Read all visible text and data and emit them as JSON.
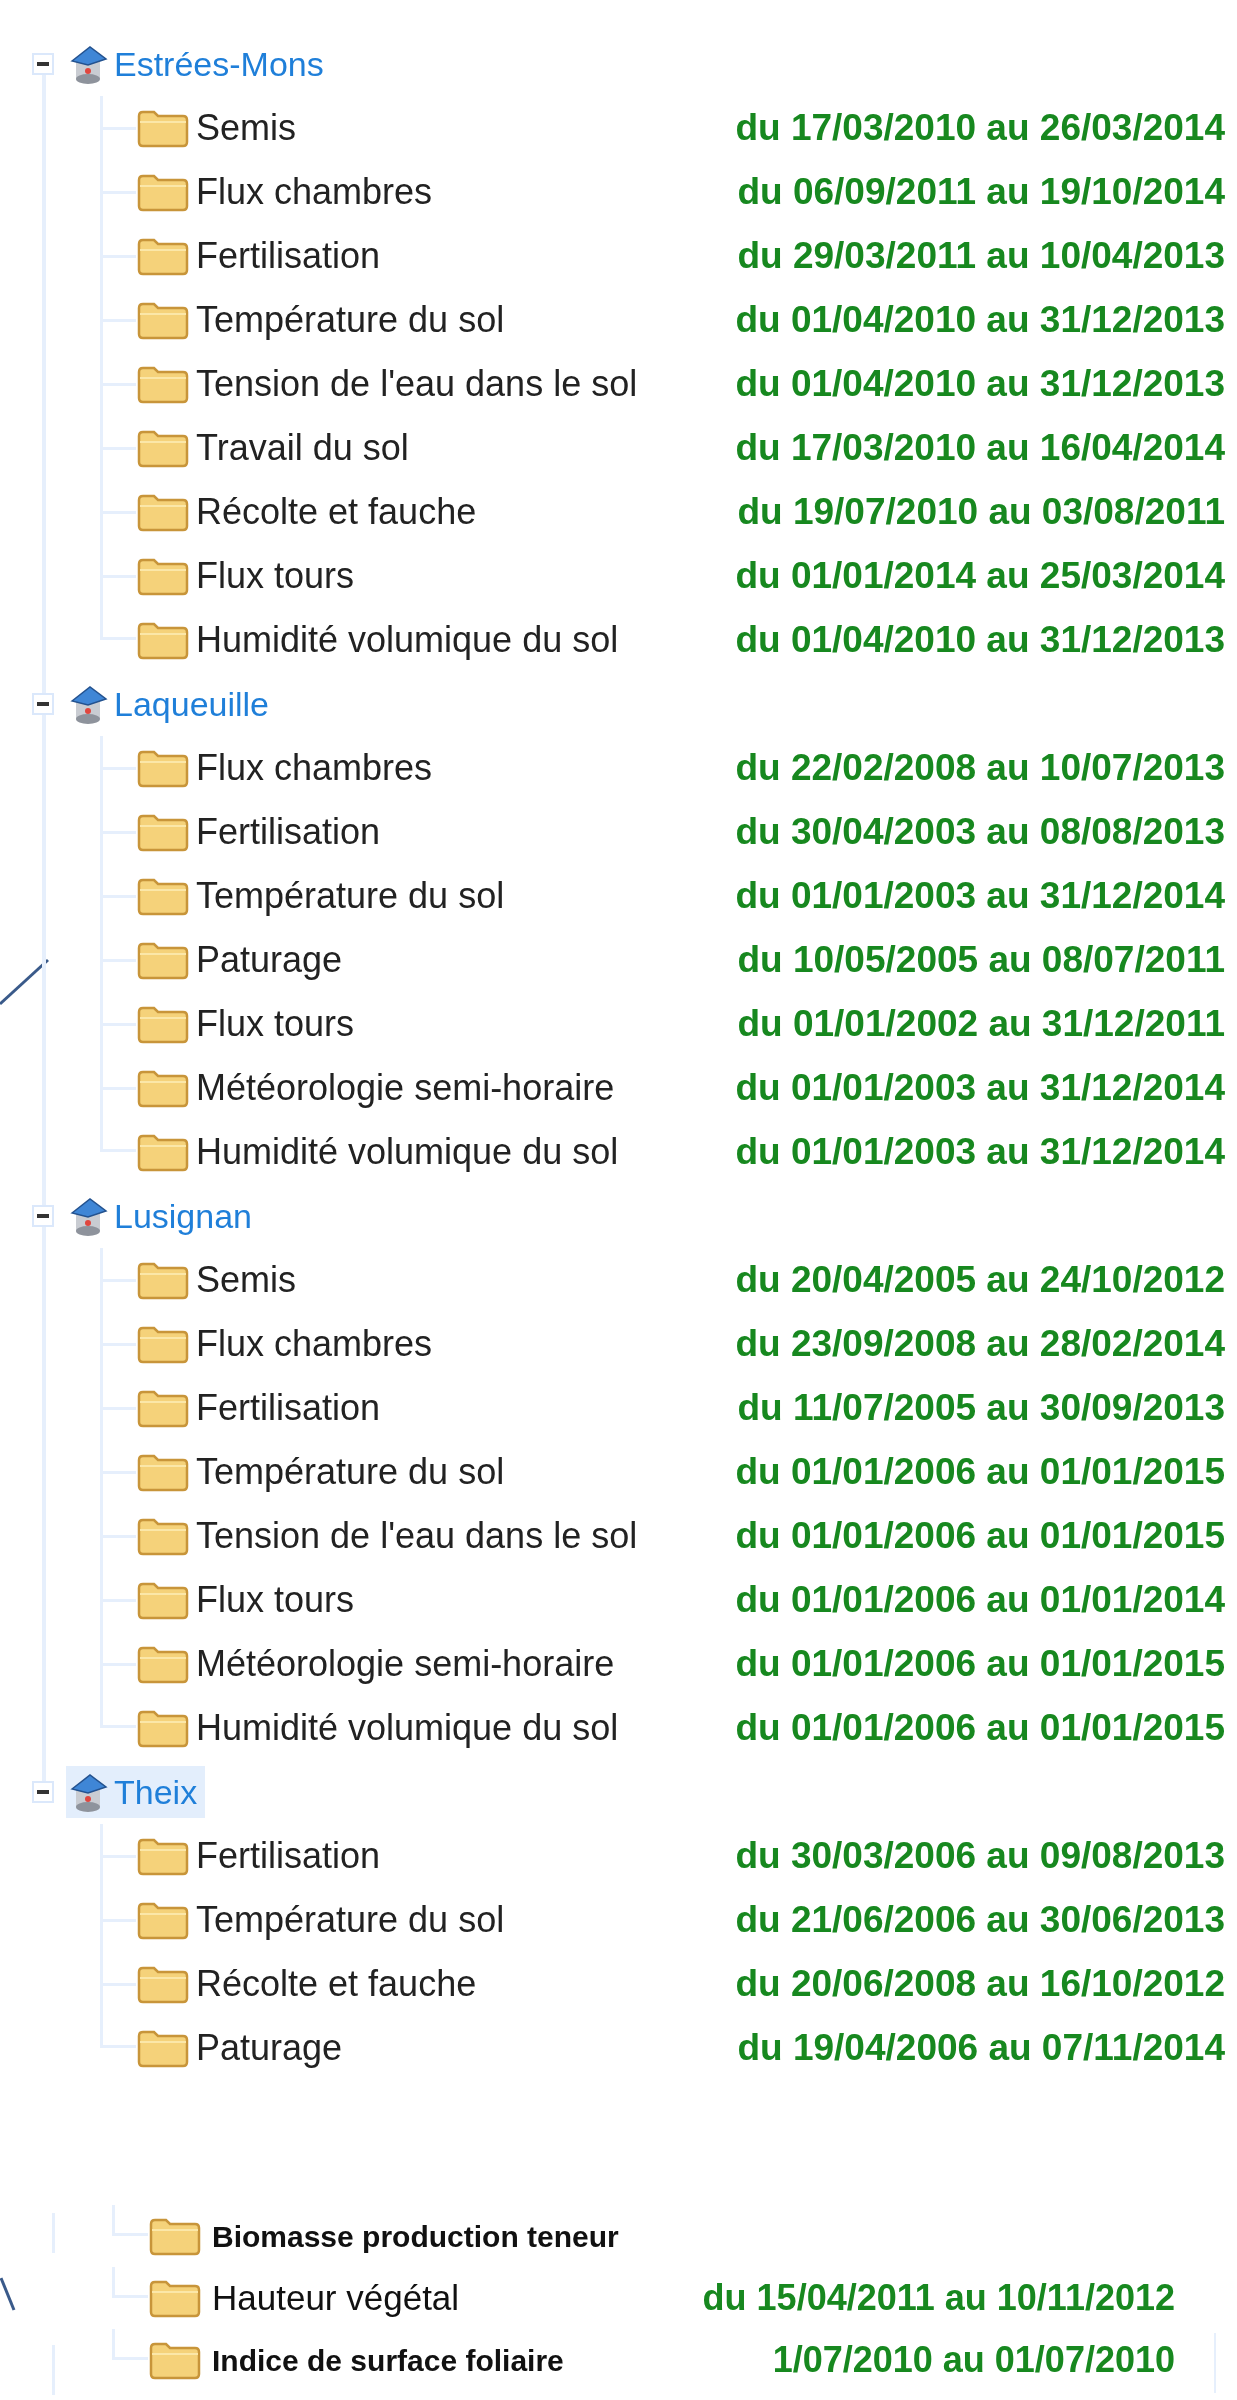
{
  "sites": [
    {
      "label": "Estrées-Mons",
      "expanded": true,
      "selected": false,
      "children": [
        {
          "label": "Semis",
          "dates": "du 17/03/2010 au 26/03/2014"
        },
        {
          "label": "Flux chambres",
          "dates": "du 06/09/2011 au 19/10/2014"
        },
        {
          "label": "Fertilisation",
          "dates": "du 29/03/2011 au 10/04/2013"
        },
        {
          "label": "Température du sol",
          "dates": "du 01/04/2010 au 31/12/2013"
        },
        {
          "label": "Tension de l'eau dans le sol",
          "dates": "du 01/04/2010 au 31/12/2013"
        },
        {
          "label": "Travail du sol",
          "dates": "du 17/03/2010 au 16/04/2014"
        },
        {
          "label": "Récolte et fauche",
          "dates": "du 19/07/2010 au 03/08/2011"
        },
        {
          "label": "Flux tours",
          "dates": "du 01/01/2014 au 25/03/2014"
        },
        {
          "label": "Humidité volumique du sol",
          "dates": "du 01/04/2010 au 31/12/2013"
        }
      ]
    },
    {
      "label": "Laqueuille",
      "expanded": true,
      "selected": false,
      "children": [
        {
          "label": "Flux chambres",
          "dates": "du 22/02/2008 au 10/07/2013"
        },
        {
          "label": "Fertilisation",
          "dates": "du 30/04/2003 au 08/08/2013"
        },
        {
          "label": "Température du sol",
          "dates": "du 01/01/2003 au 31/12/2014"
        },
        {
          "label": "Paturage",
          "dates": "du 10/05/2005 au 08/07/2011"
        },
        {
          "label": "Flux tours",
          "dates": "du 01/01/2002 au 31/12/2011"
        },
        {
          "label": "Météorologie semi-horaire",
          "dates": "du 01/01/2003 au 31/12/2014"
        },
        {
          "label": "Humidité volumique du sol",
          "dates": "du 01/01/2003 au 31/12/2014"
        }
      ]
    },
    {
      "label": "Lusignan",
      "expanded": true,
      "selected": false,
      "children": [
        {
          "label": "Semis",
          "dates": "du 20/04/2005 au 24/10/2012"
        },
        {
          "label": "Flux chambres",
          "dates": "du 23/09/2008 au 28/02/2014"
        },
        {
          "label": "Fertilisation",
          "dates": "du 11/07/2005 au 30/09/2013"
        },
        {
          "label": "Température du sol",
          "dates": "du 01/01/2006 au 01/01/2015"
        },
        {
          "label": "Tension de l'eau dans le sol",
          "dates": "du 01/01/2006 au 01/01/2015"
        },
        {
          "label": "Flux tours",
          "dates": "du 01/01/2006 au 01/01/2014"
        },
        {
          "label": "Météorologie semi-horaire",
          "dates": "du 01/01/2006 au 01/01/2015"
        },
        {
          "label": "Humidité volumique du sol",
          "dates": "du 01/01/2006 au 01/01/2015"
        }
      ]
    },
    {
      "label": "Theix",
      "expanded": true,
      "selected": true,
      "children": [
        {
          "label": "Fertilisation",
          "dates": "du 30/03/2006 au 09/08/2013"
        },
        {
          "label": "Température du sol",
          "dates": "du 21/06/2006 au 30/06/2013"
        },
        {
          "label": "Récolte et fauche",
          "dates": "du 20/06/2008 au 16/10/2012"
        },
        {
          "label": "Paturage",
          "dates": "du 19/04/2006 au 07/11/2014"
        }
      ]
    }
  ],
  "fragment": {
    "items": [
      {
        "label": "Biomasse production teneur",
        "bold": true
      },
      {
        "label": "Hauteur végétal",
        "bold": false,
        "dates": "du 15/04/2011 au 10/11/2012"
      },
      {
        "label": "Indice de surface foliaire",
        "bold": true,
        "dates": "1/07/2010 au 01/07/2010"
      }
    ]
  }
}
